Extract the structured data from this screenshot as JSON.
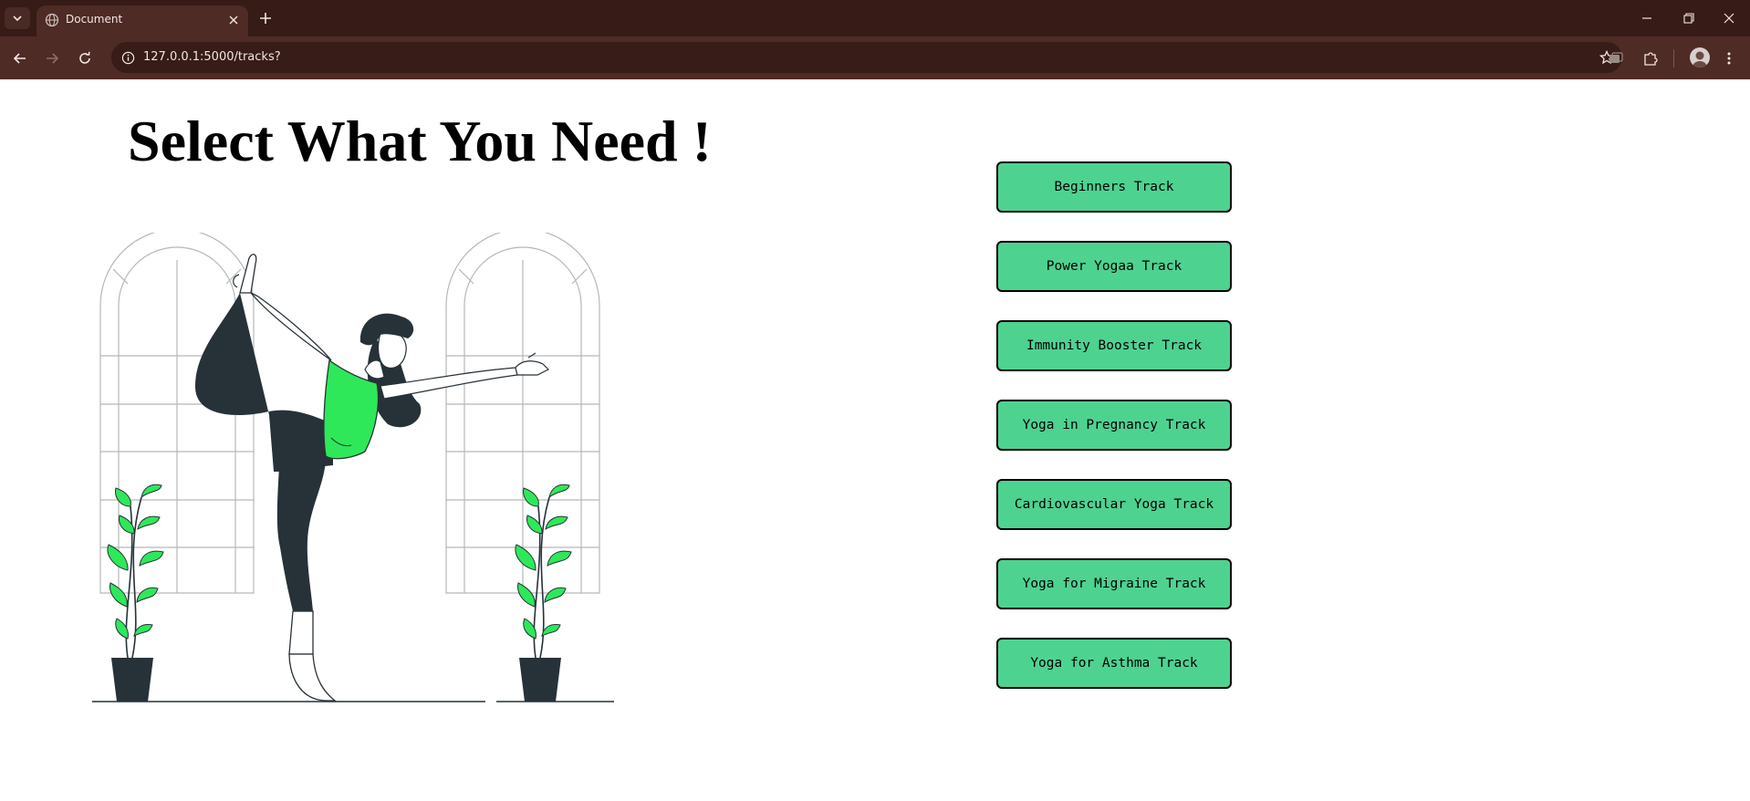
{
  "browser": {
    "tab_title": "Document",
    "url": "127.0.0.1:5000/tracks?"
  },
  "page": {
    "heading": "Select What You Need !",
    "tracks": [
      "Beginners Track",
      "Power Yogaa Track",
      "Immunity Booster Track",
      "Yoga in Pregnancy Track",
      "Cardiovascular Yoga Track",
      "Yoga for Migraine Track",
      "Yoga for Asthma Track"
    ]
  },
  "colors": {
    "chrome_dark": "#361b16",
    "chrome_toolbar": "#4e2b24",
    "button_green": "#4ed290",
    "accent_green": "#2ee85a",
    "figure_dark": "#263238"
  },
  "icons": {
    "tab_search": "chevron-down-icon",
    "favicon": "globe-icon",
    "tab_close": "close-icon",
    "new_tab": "plus-icon",
    "back": "arrow-left-icon",
    "forward": "arrow-right-icon",
    "reload": "reload-icon",
    "site_info": "info-icon",
    "bookmark": "star-icon",
    "media": "media-icon",
    "extensions": "puzzle-icon",
    "menu": "more-vertical-icon"
  }
}
